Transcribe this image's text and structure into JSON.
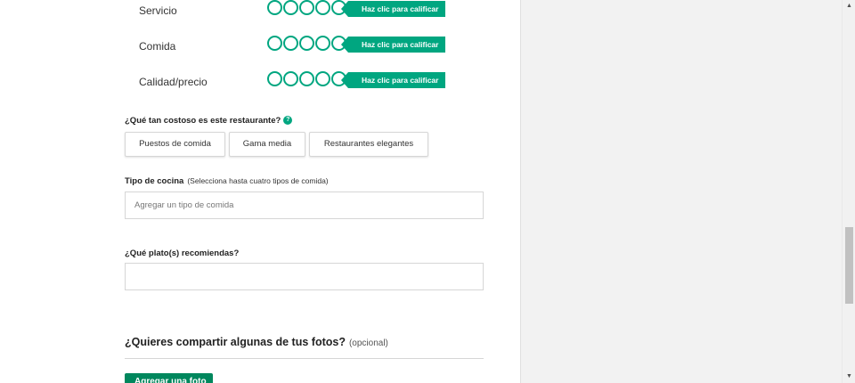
{
  "ratings": [
    {
      "label": "Servicio",
      "tag": "Haz clic para calificar"
    },
    {
      "label": "Comida",
      "tag": "Haz clic para calificar"
    },
    {
      "label": "Calidad/precio",
      "tag": "Haz clic para calificar"
    }
  ],
  "price": {
    "question": "¿Qué tan costoso es este restaurante?",
    "help_icon": "?",
    "options": [
      "Puestos de comida",
      "Gama media",
      "Restaurantes elegantes"
    ]
  },
  "cuisine": {
    "label": "Tipo de cocina",
    "hint": "(Selecciona hasta cuatro tipos de comida)",
    "placeholder": "Agregar un tipo de comida"
  },
  "dishes": {
    "label": "¿Qué plato(s) recomiendas?",
    "value": ""
  },
  "photos": {
    "title": "¿Quieres compartir algunas de tus fotos?",
    "optional": "(opcional)",
    "button_label": "Agregar una foto"
  },
  "scrollbar": {
    "up_arrow": "▲",
    "down_arrow": "▼"
  },
  "colors": {
    "accent": "#00a680",
    "button_green": "#00875d"
  }
}
